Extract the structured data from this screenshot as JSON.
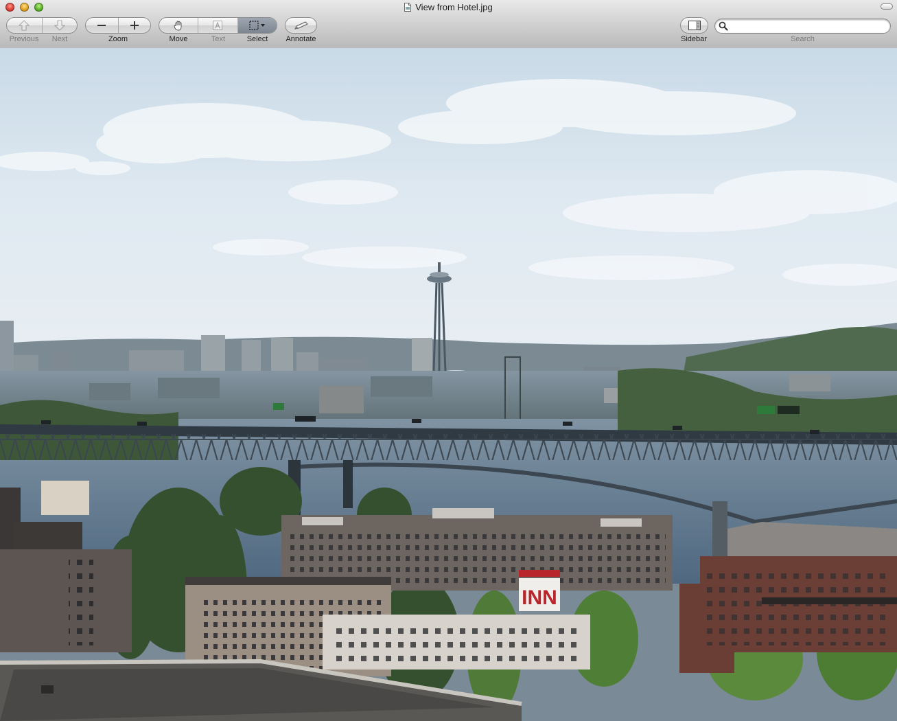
{
  "window": {
    "title": "View from Hotel.jpg"
  },
  "toolbar": {
    "previous_label": "Previous",
    "next_label": "Next",
    "zoom_label": "Zoom",
    "move_label": "Move",
    "text_label": "Text",
    "select_label": "Select",
    "annotate_label": "Annotate",
    "sidebar_label": "Sidebar",
    "search_label": "Search",
    "active_tool": "select"
  },
  "search": {
    "value": "",
    "placeholder": ""
  },
  "photo": {
    "subject": "Seattle skyline with Space Needle and bridge over lake",
    "sign_text": "INN",
    "colors": {
      "sky": "#dbe7f0",
      "water": "#5d7487",
      "bridge": "#3f4a55",
      "trees": "#3f5a37",
      "sign": "#b8262c"
    }
  }
}
